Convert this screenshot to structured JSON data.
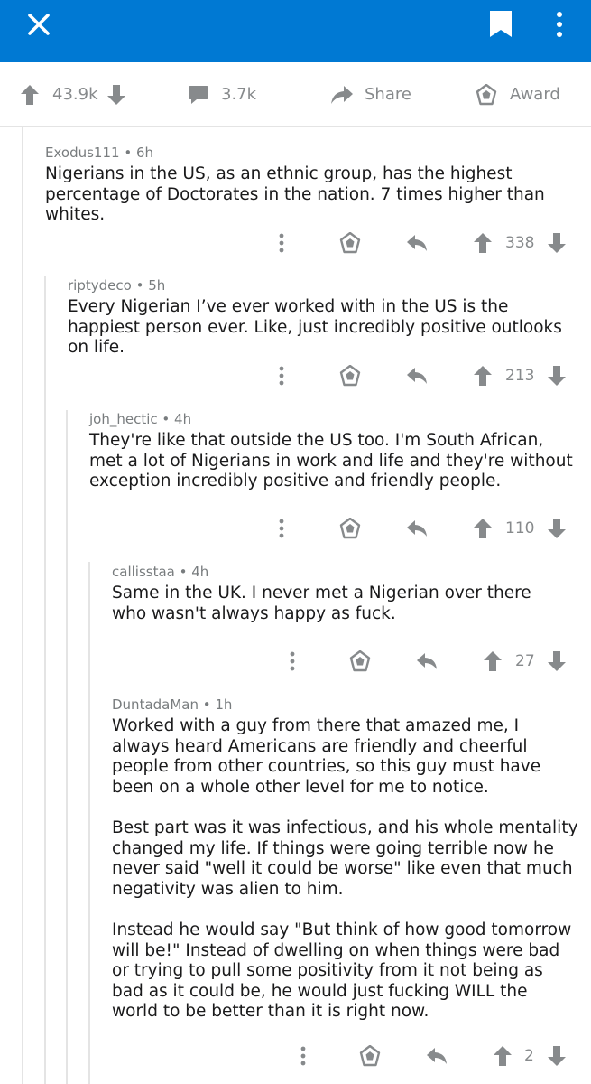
{
  "header": {
    "close_icon": "close-icon",
    "bookmark_icon": "bookmark-icon",
    "more_icon": "more-vertical-icon",
    "color": "#0079d3"
  },
  "post_actions": {
    "score": "43.9k",
    "comments": "3.7k",
    "share_label": "Share",
    "award_label": "Award"
  },
  "comments": [
    {
      "author": "Exodus111",
      "time": "6h",
      "paragraphs": [
        "Nigerians in the US, as an ethnic group, has the highest percentage of Doctorates in the nation. 7 times higher than whites."
      ],
      "score": "338"
    },
    {
      "author": "riptydeco",
      "time": "5h",
      "paragraphs": [
        "Every Nigerian I’ve ever worked with in the US is the happiest person ever.  Like, just incredibly positive outlooks on life."
      ],
      "score": "213"
    },
    {
      "author": "joh_hectic",
      "time": "4h",
      "paragraphs": [
        "They're like that outside the US too. I'm South African, met a lot of Nigerians in work and life and they're without exception incredibly positive and friendly people."
      ],
      "score": "110"
    },
    {
      "author": "callisstaa",
      "time": "4h",
      "paragraphs": [
        "Same in the UK. I never met a Nigerian over there who wasn't always happy as fuck."
      ],
      "score": "27"
    },
    {
      "author": "DuntadaMan",
      "time": "1h",
      "paragraphs": [
        "Worked with a guy from there that amazed me, I always heard Americans are friendly and cheerful people from other countries, so this guy must have been on a whole other level for me to notice.",
        "Best part was it was infectious, and his whole mentality changed my life. If things were going terrible now he never said \"well it could be worse\" like even that much negativity was alien to him.",
        "Instead he would say \"But think of how good tomorrow will be!\" Instead of dwelling on when things were bad or trying to pull some positivity from it not being as bad as it could be, he would just fucking WILL the world to be better than it is right now."
      ],
      "score": "2"
    }
  ]
}
